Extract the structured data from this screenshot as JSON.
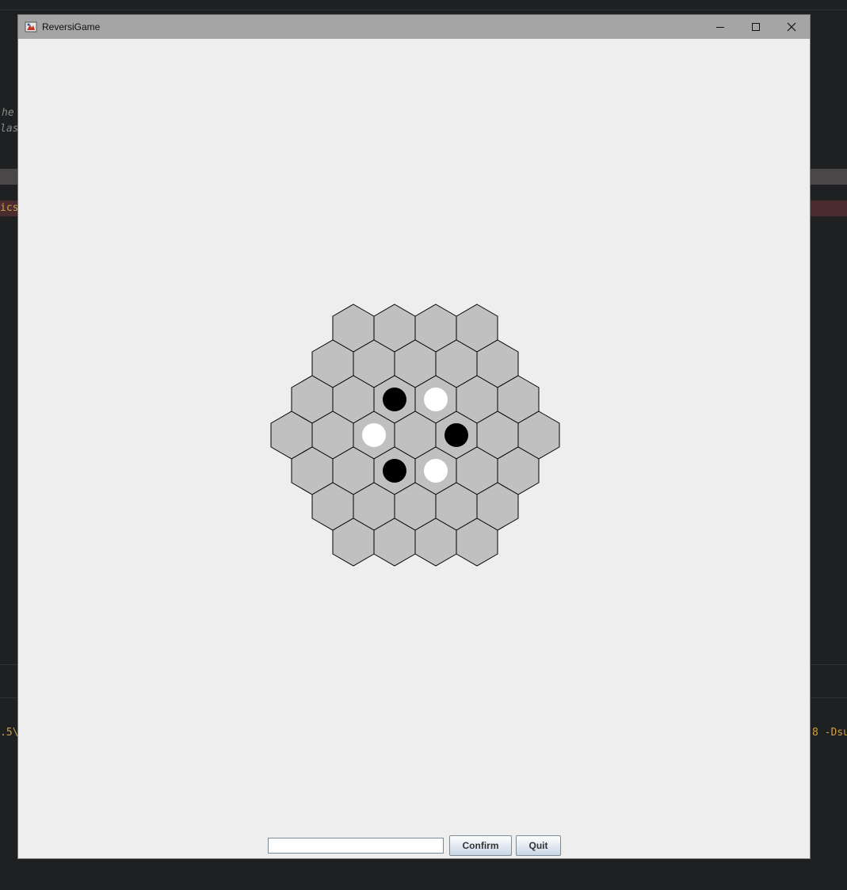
{
  "window": {
    "title": "ReversiGame"
  },
  "icons": {
    "app": "java-app-icon",
    "minimize": "minimize-icon",
    "maximize": "maximize-icon",
    "close": "close-icon"
  },
  "background": {
    "snippets": [
      "he",
      "las",
      "ics",
      ".5\\",
      "8 -Dsu"
    ]
  },
  "board": {
    "size": 4,
    "colors": {
      "cell_fill": "#c0c0c0",
      "cell_stroke": "#000000",
      "black": "#000000",
      "white": "#ffffff"
    },
    "pieces": [
      {
        "q": 0,
        "r": -1,
        "color": "black"
      },
      {
        "q": 1,
        "r": -1,
        "color": "white"
      },
      {
        "q": -1,
        "r": 0,
        "color": "white"
      },
      {
        "q": 1,
        "r": 0,
        "color": "black"
      },
      {
        "q": -1,
        "r": 1,
        "color": "black"
      },
      {
        "q": 0,
        "r": 1,
        "color": "white"
      }
    ]
  },
  "controls": {
    "input_value": "",
    "confirm_label": "Confirm",
    "quit_label": "Quit"
  }
}
